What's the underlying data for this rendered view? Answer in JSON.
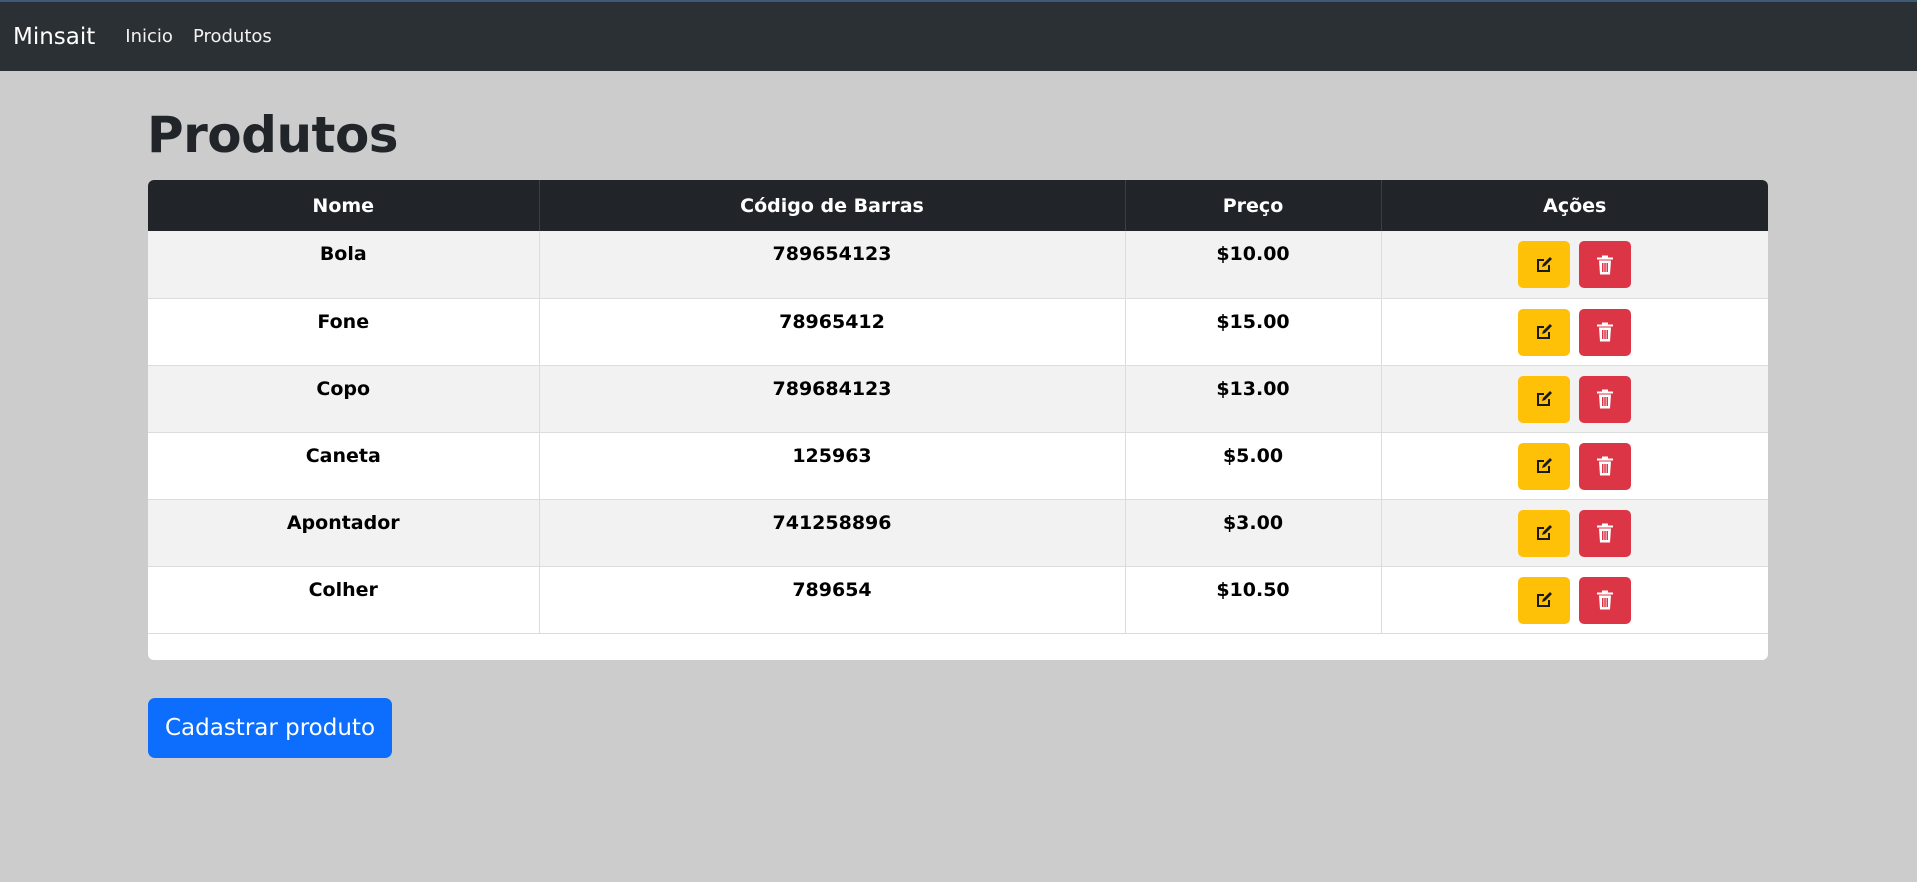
{
  "navbar": {
    "brand": "Minsait",
    "links": [
      "Inicio",
      "Produtos"
    ]
  },
  "page": {
    "title": "Produtos"
  },
  "table": {
    "headers": [
      "Nome",
      "Código de Barras",
      "Preço",
      "Ações"
    ],
    "rows": [
      {
        "nome": "Bola",
        "codigo": "789654123",
        "preco": "$10.00"
      },
      {
        "nome": "Fone",
        "codigo": "78965412",
        "preco": "$15.00"
      },
      {
        "nome": "Copo",
        "codigo": "789684123",
        "preco": "$13.00"
      },
      {
        "nome": "Caneta",
        "codigo": "125963",
        "preco": "$5.00"
      },
      {
        "nome": "Apontador",
        "codigo": "741258896",
        "preco": "$3.00"
      },
      {
        "nome": "Colher",
        "codigo": "789654",
        "preco": "$10.50"
      }
    ]
  },
  "actions": {
    "cadastrar_label": "Cadastrar produto"
  },
  "icons": {
    "edit": "edit-icon",
    "delete": "trash-icon"
  },
  "colors": {
    "navbar": "#2b3035",
    "background": "#cccccc",
    "edit_button": "#ffc107",
    "delete_button": "#dc3545",
    "primary": "#0d6efd"
  }
}
